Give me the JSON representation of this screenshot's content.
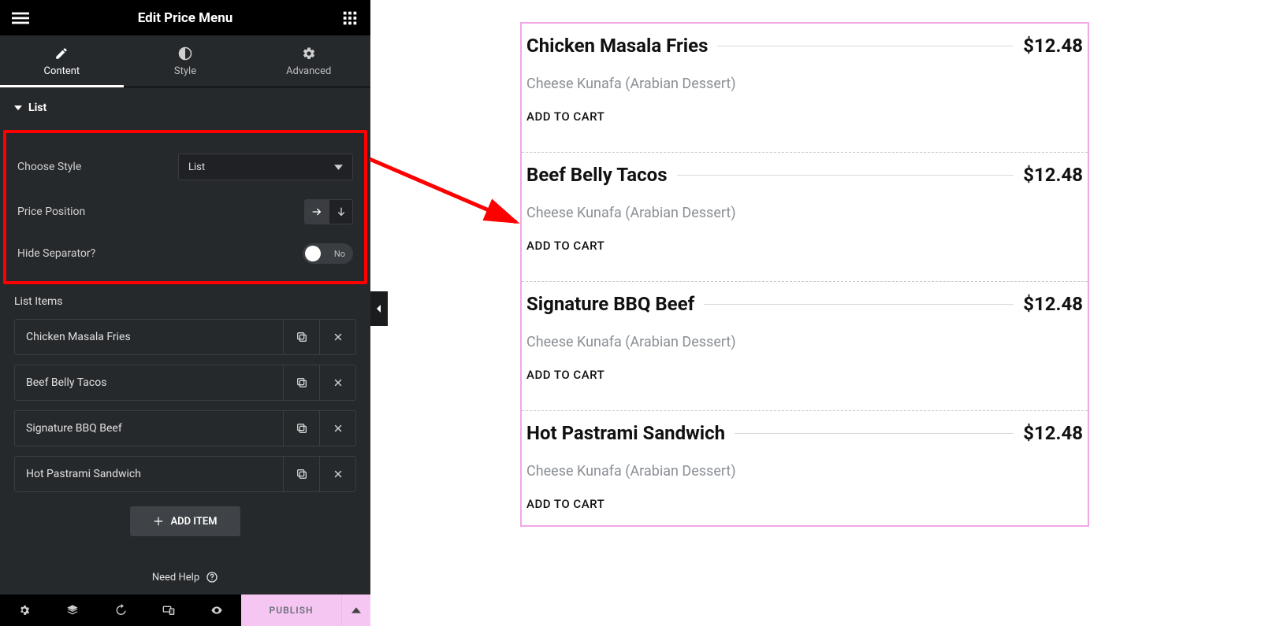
{
  "header": {
    "title": "Edit Price Menu"
  },
  "tabs": [
    {
      "label": "Content"
    },
    {
      "label": "Style"
    },
    {
      "label": "Advanced"
    }
  ],
  "section": {
    "title": "List"
  },
  "controls": {
    "choose_style": {
      "label": "Choose Style",
      "value": "List"
    },
    "price_position": {
      "label": "Price Position"
    },
    "hide_separator": {
      "label": "Hide Separator?",
      "value": "No"
    }
  },
  "list_items_label": "List Items",
  "list_items": [
    {
      "name": "Chicken Masala Fries"
    },
    {
      "name": "Beef Belly Tacos"
    },
    {
      "name": "Signature BBQ Beef"
    },
    {
      "name": "Hot Pastrami Sandwich"
    }
  ],
  "add_item_label": "ADD ITEM",
  "help_label": "Need Help",
  "footer": {
    "publish": "PUBLISH"
  },
  "preview": {
    "description": "Cheese Kunafa (Arabian Dessert)",
    "cart": "ADD TO CART",
    "items": [
      {
        "title": "Chicken Masala Fries",
        "price": "$12.48"
      },
      {
        "title": "Beef Belly Tacos",
        "price": "$12.48"
      },
      {
        "title": "Signature BBQ Beef",
        "price": "$12.48"
      },
      {
        "title": "Hot Pastrami Sandwich",
        "price": "$12.48"
      }
    ]
  }
}
